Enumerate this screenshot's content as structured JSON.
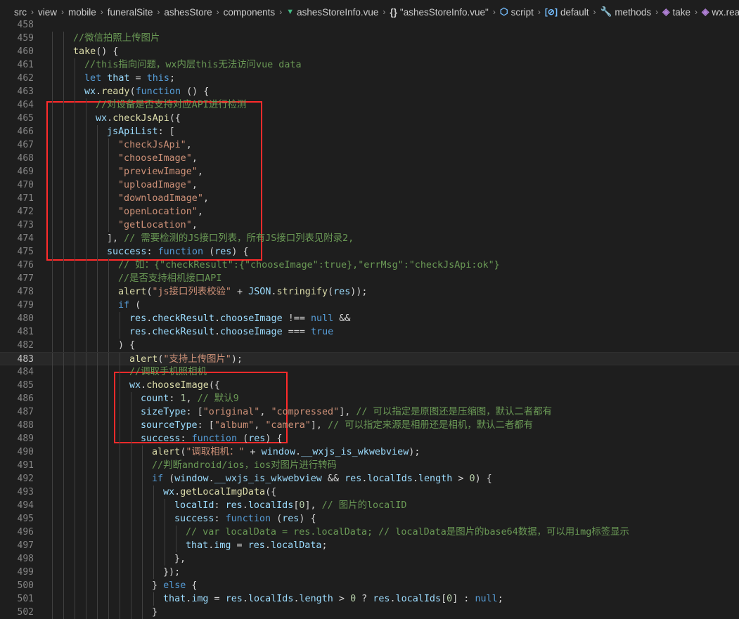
{
  "breadcrumb": [
    {
      "label": "src",
      "icon": ""
    },
    {
      "label": "view",
      "icon": ""
    },
    {
      "label": "mobile",
      "icon": ""
    },
    {
      "label": "funeralSite",
      "icon": ""
    },
    {
      "label": "ashesStore",
      "icon": ""
    },
    {
      "label": "components",
      "icon": ""
    },
    {
      "label": "ashesStoreInfo.vue",
      "icon": "vue-icon"
    },
    {
      "label": "\"ashesStoreInfo.vue\"",
      "icon": "braces-icon"
    },
    {
      "label": "script",
      "icon": "script-icon"
    },
    {
      "label": "default",
      "icon": "default-export-icon"
    },
    {
      "label": "methods",
      "icon": "methods-icon"
    },
    {
      "label": "take",
      "icon": "method-cube-icon"
    },
    {
      "label": "wx.ready(",
      "icon": "method-cube-icon"
    }
  ],
  "current_line": 483,
  "colors": {
    "background": "#1e1e1e",
    "keyword": "#569cd6",
    "function": "#dcdcaa",
    "variable": "#9cdcfe",
    "string": "#ce9178",
    "comment": "#6a9955",
    "number": "#b5cea8",
    "highlight_box": "#ff2b2b"
  },
  "lines": [
    {
      "n": "458",
      "indent": 0,
      "tokens": []
    },
    {
      "n": "459",
      "indent": 2,
      "tokens": [
        {
          "c": "//微信拍照上传图片",
          "t": "c"
        }
      ]
    },
    {
      "n": "460",
      "indent": 2,
      "tokens": [
        {
          "c": "take",
          "t": "f"
        },
        {
          "c": "() {",
          "t": "p"
        }
      ]
    },
    {
      "n": "461",
      "indent": 3,
      "tokens": [
        {
          "c": "//this指向问题，wx内层this无法访问vue data",
          "t": "c"
        }
      ]
    },
    {
      "n": "462",
      "indent": 3,
      "tokens": [
        {
          "c": "let ",
          "t": "k"
        },
        {
          "c": "that",
          "t": "v"
        },
        {
          "c": " = ",
          "t": "p"
        },
        {
          "c": "this",
          "t": "k"
        },
        {
          "c": ";",
          "t": "p"
        }
      ]
    },
    {
      "n": "463",
      "indent": 3,
      "tokens": [
        {
          "c": "wx",
          "t": "v"
        },
        {
          "c": ".",
          "t": "p"
        },
        {
          "c": "ready",
          "t": "f"
        },
        {
          "c": "(",
          "t": "p"
        },
        {
          "c": "function",
          "t": "k"
        },
        {
          "c": " () {",
          "t": "p"
        }
      ]
    },
    {
      "n": "464",
      "indent": 4,
      "tokens": [
        {
          "c": "//对设备是否支持对应API进行检测",
          "t": "c"
        }
      ]
    },
    {
      "n": "465",
      "indent": 4,
      "tokens": [
        {
          "c": "wx",
          "t": "v"
        },
        {
          "c": ".",
          "t": "p"
        },
        {
          "c": "checkJsApi",
          "t": "f"
        },
        {
          "c": "({",
          "t": "p"
        }
      ]
    },
    {
      "n": "466",
      "indent": 5,
      "tokens": [
        {
          "c": "jsApiList",
          "t": "v"
        },
        {
          "c": ": [",
          "t": "p"
        }
      ]
    },
    {
      "n": "467",
      "indent": 6,
      "tokens": [
        {
          "c": "\"checkJsApi\"",
          "t": "s"
        },
        {
          "c": ",",
          "t": "p"
        }
      ]
    },
    {
      "n": "468",
      "indent": 6,
      "tokens": [
        {
          "c": "\"chooseImage\"",
          "t": "s"
        },
        {
          "c": ",",
          "t": "p"
        }
      ]
    },
    {
      "n": "469",
      "indent": 6,
      "tokens": [
        {
          "c": "\"previewImage\"",
          "t": "s"
        },
        {
          "c": ",",
          "t": "p"
        }
      ]
    },
    {
      "n": "470",
      "indent": 6,
      "tokens": [
        {
          "c": "\"uploadImage\"",
          "t": "s"
        },
        {
          "c": ",",
          "t": "p"
        }
      ]
    },
    {
      "n": "471",
      "indent": 6,
      "tokens": [
        {
          "c": "\"downloadImage\"",
          "t": "s"
        },
        {
          "c": ",",
          "t": "p"
        }
      ]
    },
    {
      "n": "472",
      "indent": 6,
      "tokens": [
        {
          "c": "\"openLocation\"",
          "t": "s"
        },
        {
          "c": ",",
          "t": "p"
        }
      ]
    },
    {
      "n": "473",
      "indent": 6,
      "tokens": [
        {
          "c": "\"getLocation\"",
          "t": "s"
        },
        {
          "c": ",",
          "t": "p"
        }
      ]
    },
    {
      "n": "474",
      "indent": 5,
      "tokens": [
        {
          "c": "], ",
          "t": "p"
        },
        {
          "c": "// 需要检测的JS接口列表，所有JS接口列表见附录2,",
          "t": "c"
        }
      ]
    },
    {
      "n": "475",
      "indent": 5,
      "tokens": [
        {
          "c": "success",
          "t": "v"
        },
        {
          "c": ": ",
          "t": "p"
        },
        {
          "c": "function",
          "t": "k"
        },
        {
          "c": " (",
          "t": "p"
        },
        {
          "c": "res",
          "t": "v"
        },
        {
          "c": ") {",
          "t": "p"
        }
      ]
    },
    {
      "n": "476",
      "indent": 6,
      "tokens": [
        {
          "c": "// 如：{\"checkResult\":{\"chooseImage\":true},\"errMsg\":\"checkJsApi:ok\"}",
          "t": "c"
        }
      ]
    },
    {
      "n": "477",
      "indent": 6,
      "tokens": [
        {
          "c": "//是否支持相机接口API",
          "t": "c"
        }
      ]
    },
    {
      "n": "478",
      "indent": 6,
      "tokens": [
        {
          "c": "alert",
          "t": "f"
        },
        {
          "c": "(",
          "t": "p"
        },
        {
          "c": "\"js接口列表校验\"",
          "t": "s"
        },
        {
          "c": " + ",
          "t": "p"
        },
        {
          "c": "JSON",
          "t": "v"
        },
        {
          "c": ".",
          "t": "p"
        },
        {
          "c": "stringify",
          "t": "f"
        },
        {
          "c": "(",
          "t": "p"
        },
        {
          "c": "res",
          "t": "v"
        },
        {
          "c": "));",
          "t": "p"
        }
      ]
    },
    {
      "n": "479",
      "indent": 6,
      "tokens": [
        {
          "c": "if",
          "t": "k"
        },
        {
          "c": " (",
          "t": "p"
        }
      ]
    },
    {
      "n": "480",
      "indent": 7,
      "tokens": [
        {
          "c": "res",
          "t": "v"
        },
        {
          "c": ".",
          "t": "p"
        },
        {
          "c": "checkResult",
          "t": "v"
        },
        {
          "c": ".",
          "t": "p"
        },
        {
          "c": "chooseImage",
          "t": "v"
        },
        {
          "c": " !== ",
          "t": "p"
        },
        {
          "c": "null",
          "t": "k"
        },
        {
          "c": " &&",
          "t": "p"
        }
      ]
    },
    {
      "n": "481",
      "indent": 7,
      "tokens": [
        {
          "c": "res",
          "t": "v"
        },
        {
          "c": ".",
          "t": "p"
        },
        {
          "c": "checkResult",
          "t": "v"
        },
        {
          "c": ".",
          "t": "p"
        },
        {
          "c": "chooseImage",
          "t": "v"
        },
        {
          "c": " === ",
          "t": "p"
        },
        {
          "c": "true",
          "t": "k"
        }
      ]
    },
    {
      "n": "482",
      "indent": 6,
      "tokens": [
        {
          "c": ") {",
          "t": "p"
        }
      ]
    },
    {
      "n": "483",
      "indent": 7,
      "tokens": [
        {
          "c": "alert",
          "t": "f"
        },
        {
          "c": "(",
          "t": "p"
        },
        {
          "c": "\"支持上传图片\"",
          "t": "s"
        },
        {
          "c": ");",
          "t": "p"
        }
      ]
    },
    {
      "n": "484",
      "indent": 7,
      "tokens": [
        {
          "c": "//调取手机照相机",
          "t": "c"
        }
      ]
    },
    {
      "n": "485",
      "indent": 7,
      "tokens": [
        {
          "c": "wx",
          "t": "v"
        },
        {
          "c": ".",
          "t": "p"
        },
        {
          "c": "chooseImage",
          "t": "f"
        },
        {
          "c": "({",
          "t": "p"
        }
      ]
    },
    {
      "n": "486",
      "indent": 8,
      "tokens": [
        {
          "c": "count",
          "t": "v"
        },
        {
          "c": ": ",
          "t": "p"
        },
        {
          "c": "1",
          "t": "n"
        },
        {
          "c": ", ",
          "t": "p"
        },
        {
          "c": "// 默认9",
          "t": "c"
        }
      ]
    },
    {
      "n": "487",
      "indent": 8,
      "tokens": [
        {
          "c": "sizeType",
          "t": "v"
        },
        {
          "c": ": [",
          "t": "p"
        },
        {
          "c": "\"original\"",
          "t": "s"
        },
        {
          "c": ", ",
          "t": "p"
        },
        {
          "c": "\"compressed\"",
          "t": "s"
        },
        {
          "c": "], ",
          "t": "p"
        },
        {
          "c": "// 可以指定是原图还是压缩图，默认二者都有",
          "t": "c"
        }
      ]
    },
    {
      "n": "488",
      "indent": 8,
      "tokens": [
        {
          "c": "sourceType",
          "t": "v"
        },
        {
          "c": ": [",
          "t": "p"
        },
        {
          "c": "\"album\"",
          "t": "s"
        },
        {
          "c": ", ",
          "t": "p"
        },
        {
          "c": "\"camera\"",
          "t": "s"
        },
        {
          "c": "], ",
          "t": "p"
        },
        {
          "c": "// 可以指定来源是相册还是相机，默认二者都有",
          "t": "c"
        }
      ]
    },
    {
      "n": "489",
      "indent": 8,
      "tokens": [
        {
          "c": "success",
          "t": "v"
        },
        {
          "c": ": ",
          "t": "p"
        },
        {
          "c": "function",
          "t": "k"
        },
        {
          "c": " (",
          "t": "p"
        },
        {
          "c": "res",
          "t": "v"
        },
        {
          "c": ") {",
          "t": "p"
        }
      ]
    },
    {
      "n": "490",
      "indent": 9,
      "tokens": [
        {
          "c": "alert",
          "t": "f"
        },
        {
          "c": "(",
          "t": "p"
        },
        {
          "c": "\"调取相机：\"",
          "t": "s"
        },
        {
          "c": " + ",
          "t": "p"
        },
        {
          "c": "window",
          "t": "v"
        },
        {
          "c": ".",
          "t": "p"
        },
        {
          "c": "__wxjs_is_wkwebview",
          "t": "v"
        },
        {
          "c": ");",
          "t": "p"
        }
      ]
    },
    {
      "n": "491",
      "indent": 9,
      "tokens": [
        {
          "c": "//判断android/ios，ios对图片进行转码",
          "t": "c"
        }
      ]
    },
    {
      "n": "492",
      "indent": 9,
      "tokens": [
        {
          "c": "if",
          "t": "k"
        },
        {
          "c": " (",
          "t": "p"
        },
        {
          "c": "window",
          "t": "v"
        },
        {
          "c": ".",
          "t": "p"
        },
        {
          "c": "__wxjs_is_wkwebview",
          "t": "v"
        },
        {
          "c": " && ",
          "t": "p"
        },
        {
          "c": "res",
          "t": "v"
        },
        {
          "c": ".",
          "t": "p"
        },
        {
          "c": "localIds",
          "t": "v"
        },
        {
          "c": ".",
          "t": "p"
        },
        {
          "c": "length",
          "t": "v"
        },
        {
          "c": " > ",
          "t": "p"
        },
        {
          "c": "0",
          "t": "n"
        },
        {
          "c": ") {",
          "t": "p"
        }
      ]
    },
    {
      "n": "493",
      "indent": 10,
      "tokens": [
        {
          "c": "wx",
          "t": "v"
        },
        {
          "c": ".",
          "t": "p"
        },
        {
          "c": "getLocalImgData",
          "t": "f"
        },
        {
          "c": "({",
          "t": "p"
        }
      ]
    },
    {
      "n": "494",
      "indent": 11,
      "tokens": [
        {
          "c": "localId",
          "t": "v"
        },
        {
          "c": ": ",
          "t": "p"
        },
        {
          "c": "res",
          "t": "v"
        },
        {
          "c": ".",
          "t": "p"
        },
        {
          "c": "localIds",
          "t": "v"
        },
        {
          "c": "[",
          "t": "p"
        },
        {
          "c": "0",
          "t": "n"
        },
        {
          "c": "], ",
          "t": "p"
        },
        {
          "c": "// 图片的localID",
          "t": "c"
        }
      ]
    },
    {
      "n": "495",
      "indent": 11,
      "tokens": [
        {
          "c": "success",
          "t": "v"
        },
        {
          "c": ": ",
          "t": "p"
        },
        {
          "c": "function",
          "t": "k"
        },
        {
          "c": " (",
          "t": "p"
        },
        {
          "c": "res",
          "t": "v"
        },
        {
          "c": ") {",
          "t": "p"
        }
      ]
    },
    {
      "n": "496",
      "indent": 12,
      "tokens": [
        {
          "c": "// var localData = res.localData; // localData是图片的base64数据，可以用img标签显示",
          "t": "c"
        }
      ]
    },
    {
      "n": "497",
      "indent": 12,
      "tokens": [
        {
          "c": "that",
          "t": "v"
        },
        {
          "c": ".",
          "t": "p"
        },
        {
          "c": "img",
          "t": "v"
        },
        {
          "c": " = ",
          "t": "p"
        },
        {
          "c": "res",
          "t": "v"
        },
        {
          "c": ".",
          "t": "p"
        },
        {
          "c": "localData",
          "t": "v"
        },
        {
          "c": ";",
          "t": "p"
        }
      ]
    },
    {
      "n": "498",
      "indent": 11,
      "tokens": [
        {
          "c": "},",
          "t": "p"
        }
      ]
    },
    {
      "n": "499",
      "indent": 10,
      "tokens": [
        {
          "c": "});",
          "t": "p"
        }
      ]
    },
    {
      "n": "500",
      "indent": 9,
      "tokens": [
        {
          "c": "} ",
          "t": "p"
        },
        {
          "c": "else",
          "t": "k"
        },
        {
          "c": " {",
          "t": "p"
        }
      ]
    },
    {
      "n": "501",
      "indent": 10,
      "tokens": [
        {
          "c": "that",
          "t": "v"
        },
        {
          "c": ".",
          "t": "p"
        },
        {
          "c": "img",
          "t": "v"
        },
        {
          "c": " = ",
          "t": "p"
        },
        {
          "c": "res",
          "t": "v"
        },
        {
          "c": ".",
          "t": "p"
        },
        {
          "c": "localIds",
          "t": "v"
        },
        {
          "c": ".",
          "t": "p"
        },
        {
          "c": "length",
          "t": "v"
        },
        {
          "c": " > ",
          "t": "p"
        },
        {
          "c": "0",
          "t": "n"
        },
        {
          "c": " ? ",
          "t": "p"
        },
        {
          "c": "res",
          "t": "v"
        },
        {
          "c": ".",
          "t": "p"
        },
        {
          "c": "localIds",
          "t": "v"
        },
        {
          "c": "[",
          "t": "p"
        },
        {
          "c": "0",
          "t": "n"
        },
        {
          "c": "] : ",
          "t": "p"
        },
        {
          "c": "null",
          "t": "k"
        },
        {
          "c": ";",
          "t": "p"
        }
      ]
    },
    {
      "n": "502",
      "indent": 9,
      "tokens": [
        {
          "c": "}",
          "t": "p"
        }
      ]
    }
  ]
}
